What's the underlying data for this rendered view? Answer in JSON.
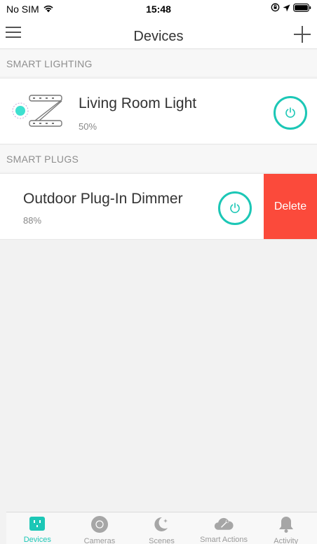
{
  "status_bar": {
    "carrier": "No SIM",
    "time": "15:48"
  },
  "nav": {
    "title": "Devices"
  },
  "sections": [
    {
      "header": "SMART LIGHTING",
      "devices": [
        {
          "name": "Living Room Light",
          "level": "50%"
        }
      ]
    },
    {
      "header": "SMART PLUGS",
      "devices": [
        {
          "name": "Outdoor Plug-In Dimmer",
          "level": "88%",
          "swipe_action": "Delete"
        }
      ]
    }
  ],
  "tabs": [
    {
      "label": "Devices",
      "icon": "plug-icon",
      "active": true
    },
    {
      "label": "Cameras",
      "icon": "camera-icon",
      "active": false
    },
    {
      "label": "Scenes",
      "icon": "moon-icon",
      "active": false
    },
    {
      "label": "Smart Actions",
      "icon": "cloud-wand-icon",
      "active": false
    },
    {
      "label": "Activity",
      "icon": "bell-icon",
      "active": false
    }
  ],
  "colors": {
    "accent": "#1cc7b6",
    "delete": "#fb4a3b",
    "background": "#f2f2f2"
  }
}
